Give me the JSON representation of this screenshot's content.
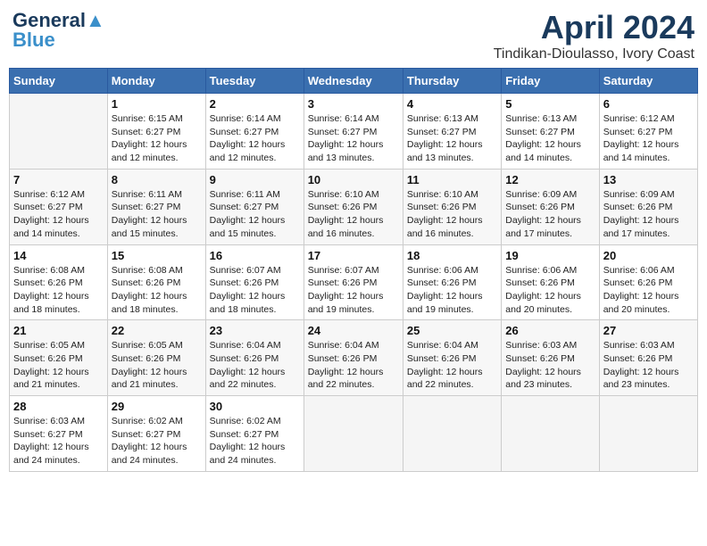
{
  "header": {
    "logo_general": "General",
    "logo_blue": "Blue",
    "title": "April 2024",
    "subtitle": "Tindikan-Dioulasso, Ivory Coast"
  },
  "calendar": {
    "weekdays": [
      "Sunday",
      "Monday",
      "Tuesday",
      "Wednesday",
      "Thursday",
      "Friday",
      "Saturday"
    ],
    "weeks": [
      [
        {
          "day": "",
          "info": ""
        },
        {
          "day": "1",
          "info": "Sunrise: 6:15 AM\nSunset: 6:27 PM\nDaylight: 12 hours\nand 12 minutes."
        },
        {
          "day": "2",
          "info": "Sunrise: 6:14 AM\nSunset: 6:27 PM\nDaylight: 12 hours\nand 12 minutes."
        },
        {
          "day": "3",
          "info": "Sunrise: 6:14 AM\nSunset: 6:27 PM\nDaylight: 12 hours\nand 13 minutes."
        },
        {
          "day": "4",
          "info": "Sunrise: 6:13 AM\nSunset: 6:27 PM\nDaylight: 12 hours\nand 13 minutes."
        },
        {
          "day": "5",
          "info": "Sunrise: 6:13 AM\nSunset: 6:27 PM\nDaylight: 12 hours\nand 14 minutes."
        },
        {
          "day": "6",
          "info": "Sunrise: 6:12 AM\nSunset: 6:27 PM\nDaylight: 12 hours\nand 14 minutes."
        }
      ],
      [
        {
          "day": "7",
          "info": "Sunrise: 6:12 AM\nSunset: 6:27 PM\nDaylight: 12 hours\nand 14 minutes."
        },
        {
          "day": "8",
          "info": "Sunrise: 6:11 AM\nSunset: 6:27 PM\nDaylight: 12 hours\nand 15 minutes."
        },
        {
          "day": "9",
          "info": "Sunrise: 6:11 AM\nSunset: 6:27 PM\nDaylight: 12 hours\nand 15 minutes."
        },
        {
          "day": "10",
          "info": "Sunrise: 6:10 AM\nSunset: 6:26 PM\nDaylight: 12 hours\nand 16 minutes."
        },
        {
          "day": "11",
          "info": "Sunrise: 6:10 AM\nSunset: 6:26 PM\nDaylight: 12 hours\nand 16 minutes."
        },
        {
          "day": "12",
          "info": "Sunrise: 6:09 AM\nSunset: 6:26 PM\nDaylight: 12 hours\nand 17 minutes."
        },
        {
          "day": "13",
          "info": "Sunrise: 6:09 AM\nSunset: 6:26 PM\nDaylight: 12 hours\nand 17 minutes."
        }
      ],
      [
        {
          "day": "14",
          "info": "Sunrise: 6:08 AM\nSunset: 6:26 PM\nDaylight: 12 hours\nand 18 minutes."
        },
        {
          "day": "15",
          "info": "Sunrise: 6:08 AM\nSunset: 6:26 PM\nDaylight: 12 hours\nand 18 minutes."
        },
        {
          "day": "16",
          "info": "Sunrise: 6:07 AM\nSunset: 6:26 PM\nDaylight: 12 hours\nand 18 minutes."
        },
        {
          "day": "17",
          "info": "Sunrise: 6:07 AM\nSunset: 6:26 PM\nDaylight: 12 hours\nand 19 minutes."
        },
        {
          "day": "18",
          "info": "Sunrise: 6:06 AM\nSunset: 6:26 PM\nDaylight: 12 hours\nand 19 minutes."
        },
        {
          "day": "19",
          "info": "Sunrise: 6:06 AM\nSunset: 6:26 PM\nDaylight: 12 hours\nand 20 minutes."
        },
        {
          "day": "20",
          "info": "Sunrise: 6:06 AM\nSunset: 6:26 PM\nDaylight: 12 hours\nand 20 minutes."
        }
      ],
      [
        {
          "day": "21",
          "info": "Sunrise: 6:05 AM\nSunset: 6:26 PM\nDaylight: 12 hours\nand 21 minutes."
        },
        {
          "day": "22",
          "info": "Sunrise: 6:05 AM\nSunset: 6:26 PM\nDaylight: 12 hours\nand 21 minutes."
        },
        {
          "day": "23",
          "info": "Sunrise: 6:04 AM\nSunset: 6:26 PM\nDaylight: 12 hours\nand 22 minutes."
        },
        {
          "day": "24",
          "info": "Sunrise: 6:04 AM\nSunset: 6:26 PM\nDaylight: 12 hours\nand 22 minutes."
        },
        {
          "day": "25",
          "info": "Sunrise: 6:04 AM\nSunset: 6:26 PM\nDaylight: 12 hours\nand 22 minutes."
        },
        {
          "day": "26",
          "info": "Sunrise: 6:03 AM\nSunset: 6:26 PM\nDaylight: 12 hours\nand 23 minutes."
        },
        {
          "day": "27",
          "info": "Sunrise: 6:03 AM\nSunset: 6:26 PM\nDaylight: 12 hours\nand 23 minutes."
        }
      ],
      [
        {
          "day": "28",
          "info": "Sunrise: 6:03 AM\nSunset: 6:27 PM\nDaylight: 12 hours\nand 24 minutes."
        },
        {
          "day": "29",
          "info": "Sunrise: 6:02 AM\nSunset: 6:27 PM\nDaylight: 12 hours\nand 24 minutes."
        },
        {
          "day": "30",
          "info": "Sunrise: 6:02 AM\nSunset: 6:27 PM\nDaylight: 12 hours\nand 24 minutes."
        },
        {
          "day": "",
          "info": ""
        },
        {
          "day": "",
          "info": ""
        },
        {
          "day": "",
          "info": ""
        },
        {
          "day": "",
          "info": ""
        }
      ]
    ]
  }
}
